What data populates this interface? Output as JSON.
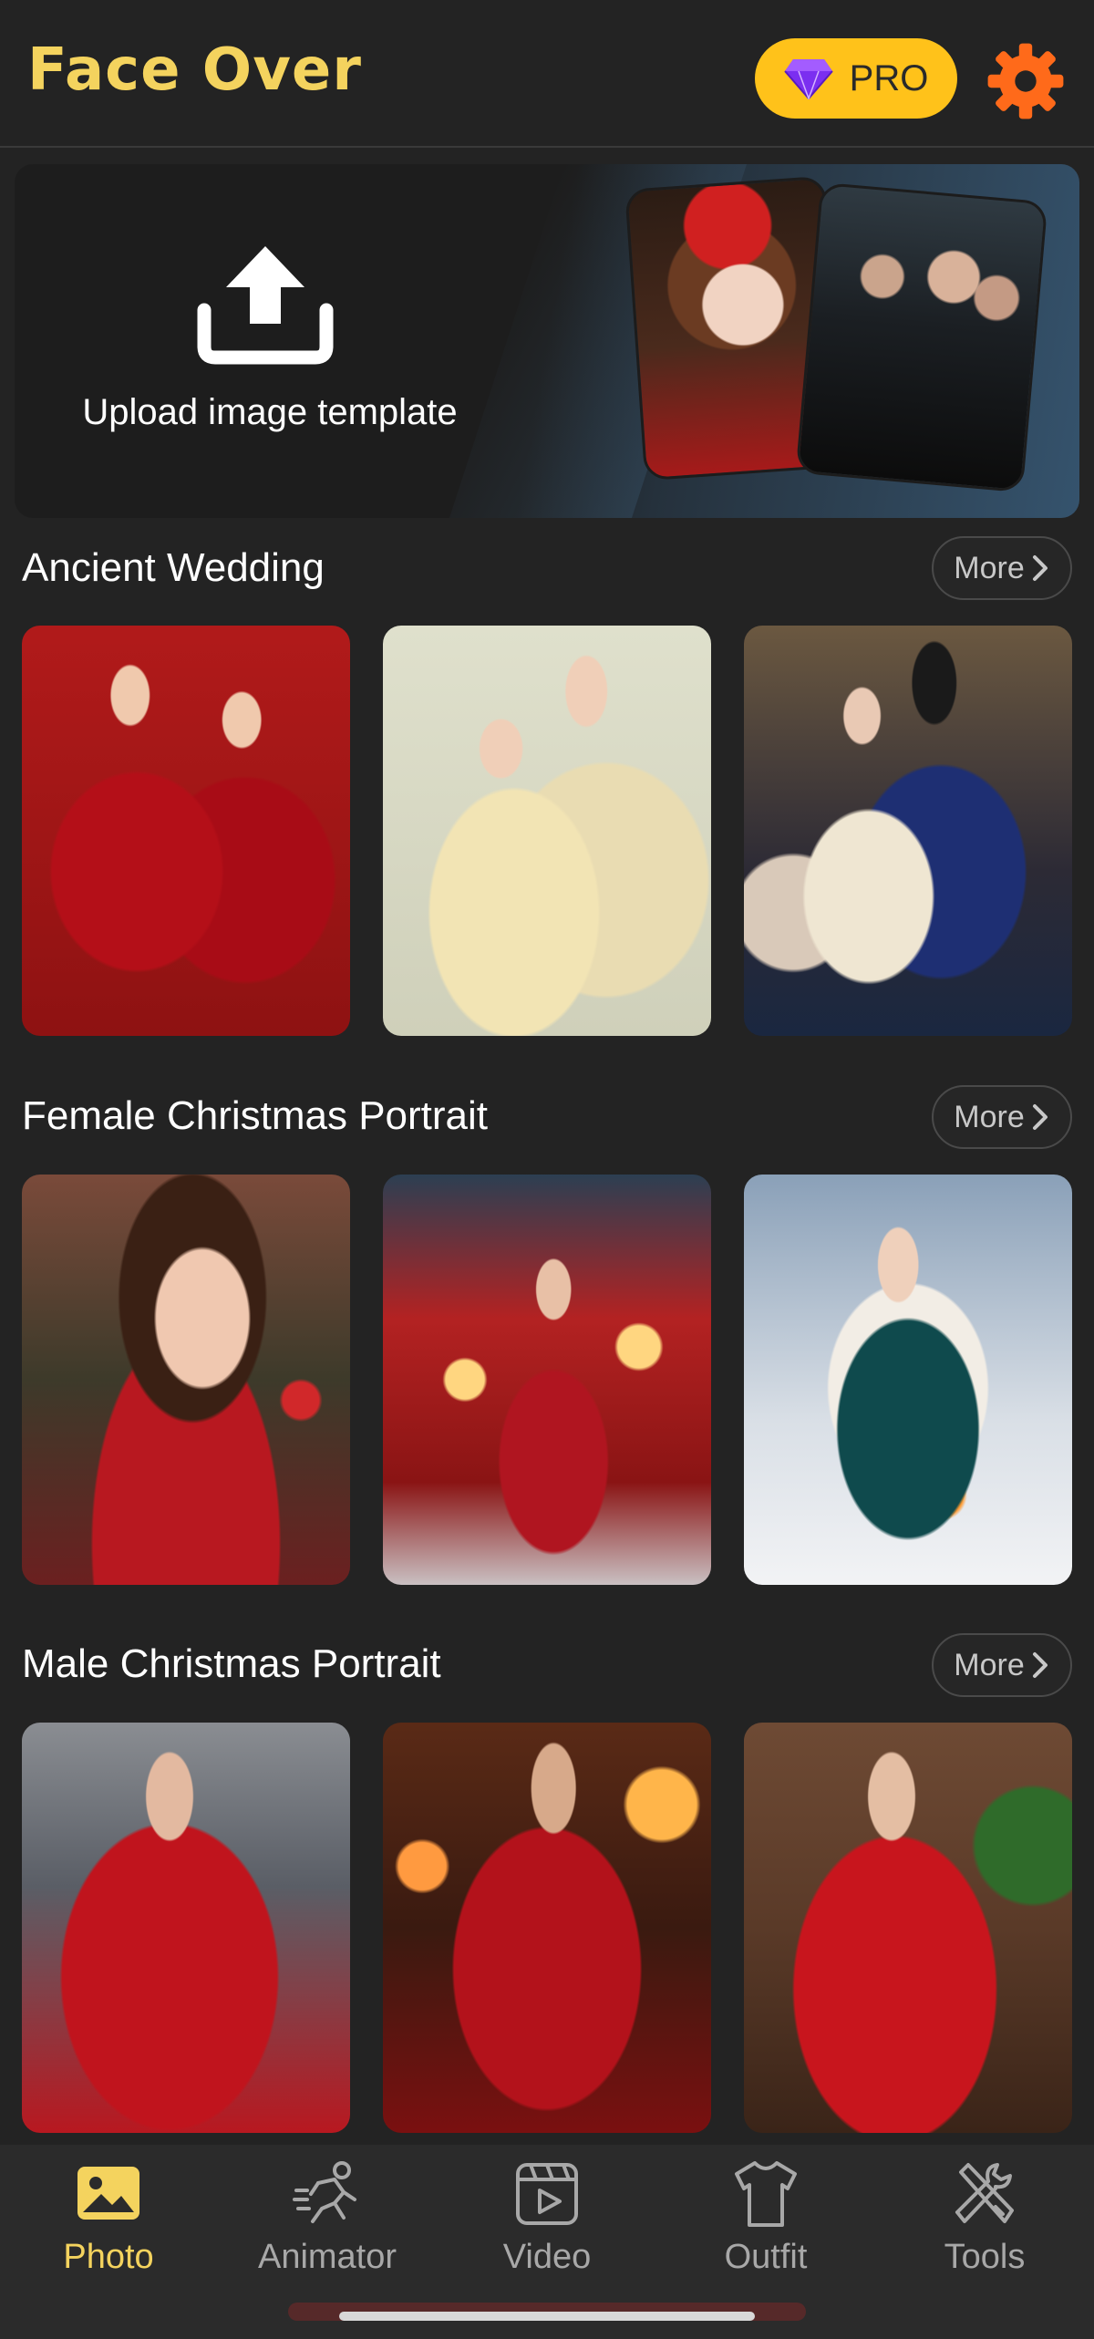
{
  "header": {
    "title": "Face Over",
    "pro_label": "PRO",
    "colors": {
      "title": "#f4d35e",
      "pro_bg": "#ffc21a",
      "gear": "#ff6a1a"
    }
  },
  "banner": {
    "upload_label": "Upload image template"
  },
  "sections": [
    {
      "title": "Ancient Wedding",
      "more_label": "More"
    },
    {
      "title": "Female Christmas Portrait",
      "more_label": "More"
    },
    {
      "title": "Male Christmas Portrait",
      "more_label": "More"
    }
  ],
  "nav": {
    "items": [
      {
        "label": "Photo",
        "icon": "photo-icon",
        "active": true
      },
      {
        "label": "Animator",
        "icon": "running-figure-icon",
        "active": false
      },
      {
        "label": "Video",
        "icon": "video-play-icon",
        "active": false
      },
      {
        "label": "Outfit",
        "icon": "tshirt-icon",
        "active": false
      },
      {
        "label": "Tools",
        "icon": "tools-icon",
        "active": false
      }
    ],
    "colors": {
      "active": "#f4d35e",
      "inactive": "#a8a8a8"
    }
  }
}
